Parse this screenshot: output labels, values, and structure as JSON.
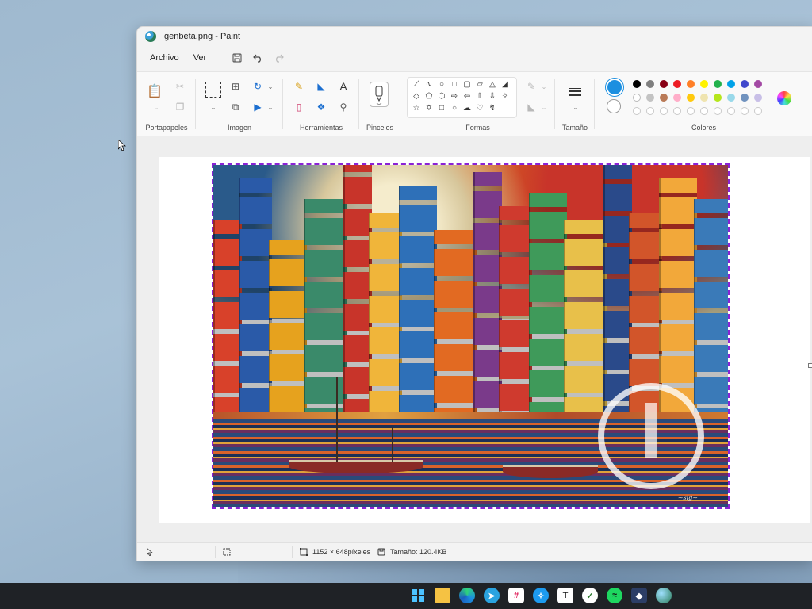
{
  "window": {
    "title": "genbeta.png - Paint"
  },
  "menu": {
    "file": "Archivo",
    "view": "Ver"
  },
  "ribbon": {
    "groups": {
      "clipboard": "Portapapeles",
      "image": "Imagen",
      "tools": "Herramientas",
      "brushes": "Pinceles",
      "shapes": "Formas",
      "size": "Tamaño",
      "colors": "Colores"
    },
    "primary_color": "#1c8fe0",
    "secondary_color": "#ffffff",
    "palette_row1": [
      "#000000",
      "#7f7f7f",
      "#880015",
      "#ed1c24",
      "#ff7f27",
      "#fff200",
      "#22b14c",
      "#00a2e8",
      "#3f48cc",
      "#a349a4"
    ],
    "palette_row2": [
      "#ffffff",
      "#c3c3c3",
      "#b97a57",
      "#ffaec9",
      "#ffc90e",
      "#efe4b0",
      "#b5e61d",
      "#99d9ea",
      "#7092be",
      "#c8bfe7"
    ]
  },
  "status": {
    "dimensions": "1152 × 648píxeles",
    "file_size": "Tamaño: 120.4KB"
  },
  "taskbar": {
    "apps": [
      "start",
      "file-explorer",
      "edge",
      "telegram",
      "slack",
      "twitter",
      "typora",
      "todo",
      "spotify",
      "app",
      "globe"
    ]
  }
}
